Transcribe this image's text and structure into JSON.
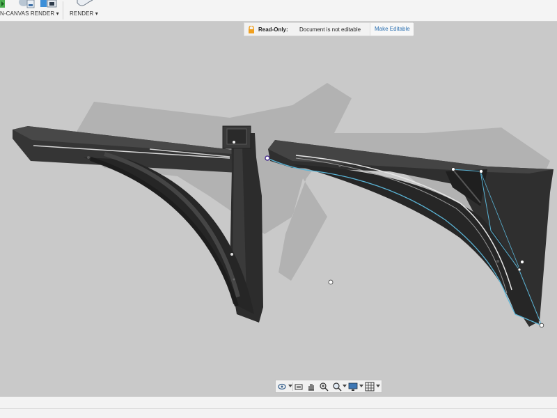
{
  "toolbar": {
    "in_canvas_render_label": "N-CANVAS RENDER ▾",
    "render_label": "RENDER ▾"
  },
  "notice": {
    "status_label": "Read-Only:",
    "message": "Document is not editable",
    "action_label": "Make Editable"
  },
  "navigation_bar": {
    "icons": [
      "orbit-icon",
      "look-at-icon",
      "pan-icon",
      "zoom-icon",
      "fit-window-icon",
      "display-settings-icon",
      "grid-settings-icon"
    ]
  },
  "colors": {
    "viewport_background": "#c9c9c9",
    "model_body": "#2f2f2f",
    "selection_highlight": "#5ab4d6",
    "link_blue": "#2a6fb0",
    "lock_orange": "#f0a020"
  }
}
